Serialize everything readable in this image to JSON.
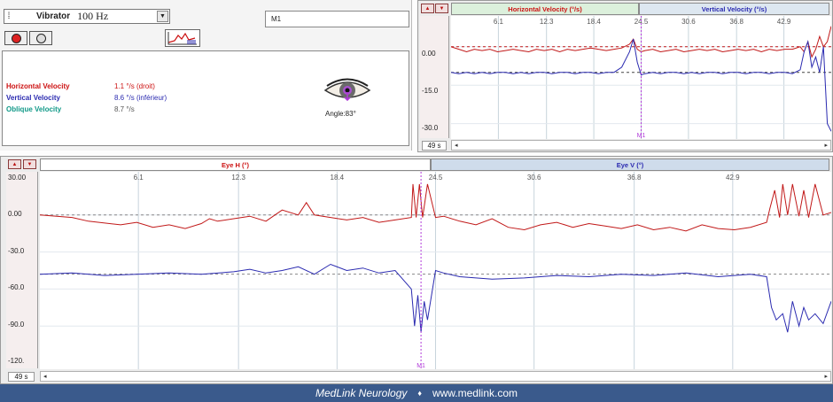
{
  "vibrator": {
    "label": "Vibrator",
    "value": "100 Hz"
  },
  "marker_field": "M1",
  "velocities": {
    "horizontal": {
      "label": "Horizontal Velocity",
      "value": "1.1 °/s (droit)"
    },
    "vertical": {
      "label": "Vertical Velocity",
      "value": "8.6 °/s (inférieur)"
    },
    "oblique": {
      "label": "Oblique Velocity",
      "value": "8.7 °/s"
    }
  },
  "angle_label": "Angle:83°",
  "small_chart": {
    "tabs": [
      "Horizontal Velocity (°/s)",
      "Vertical Velocity (°/s)"
    ],
    "y_ticks": [
      "0.00",
      "-15.0",
      "-30.0"
    ],
    "x_ticks": [
      "6.1",
      "12.3",
      "18.4",
      "24.5",
      "30.6",
      "36.8",
      "42.9"
    ],
    "time_window": "49 s",
    "cursor_label": "M1"
  },
  "big_chart": {
    "tabs": [
      "Eye H (°)",
      "Eye V (°)"
    ],
    "y_ticks": [
      "30.00",
      "0.00",
      "-30.0",
      "-60.0",
      "-90.0",
      "-120."
    ],
    "x_ticks": [
      "6.1",
      "12.3",
      "18.4",
      "24.5",
      "30.6",
      "36.8",
      "42.9"
    ],
    "time_window": "49 s",
    "cursor_label": "M1"
  },
  "chart_data": [
    {
      "type": "line",
      "title": "",
      "xlabel": "",
      "ylabel": "",
      "x_ticks": [
        6.1,
        12.3,
        18.4,
        24.5,
        30.6,
        36.8,
        42.9
      ],
      "xlim": [
        0,
        49
      ],
      "ylim": [
        -36,
        12
      ],
      "series": [
        {
          "name": "Horizontal Velocity (°/s)",
          "color": "#c11818",
          "x": [
            0,
            1,
            2,
            3,
            4,
            5,
            6,
            7,
            8,
            9,
            10,
            11,
            12,
            13,
            14,
            15,
            16,
            17,
            18,
            19,
            20,
            21,
            22,
            23,
            23.5,
            24,
            24.5,
            25,
            26,
            27,
            28,
            29,
            30,
            31,
            32,
            33,
            34,
            35,
            36,
            37,
            38,
            39,
            40,
            41,
            42,
            43,
            44,
            45,
            45.5,
            46,
            46.5,
            47,
            47.5,
            48,
            48.5,
            49
          ],
          "y": [
            0,
            -1,
            -2,
            -1,
            -1.5,
            -1,
            -2,
            -1.5,
            -1,
            -1.5,
            -2,
            -1,
            -1.5,
            -1,
            -2,
            -1,
            -1.5,
            -1,
            -0.5,
            -1,
            -1.5,
            -1,
            -0.5,
            1,
            3,
            -1,
            -2,
            -1.5,
            -1,
            -2,
            -1.5,
            -1,
            -2,
            -1.5,
            -1,
            -1.5,
            -1,
            -2,
            -1.5,
            -1,
            -1.5,
            -1,
            -2,
            -1,
            -1.5,
            -1,
            -1,
            0,
            -2,
            2,
            -4,
            -1,
            4,
            0,
            2,
            8
          ]
        },
        {
          "name": "Vertical Velocity (°/s)",
          "color": "#2a2ab0",
          "x": [
            0,
            1,
            2,
            3,
            4,
            5,
            6,
            7,
            8,
            9,
            10,
            11,
            12,
            13,
            14,
            15,
            16,
            17,
            18,
            19,
            20,
            21,
            22,
            23,
            23.5,
            24,
            24.5,
            25,
            26,
            27,
            28,
            29,
            30,
            31,
            32,
            33,
            34,
            35,
            36,
            37,
            38,
            39,
            40,
            41,
            42,
            43,
            44,
            45,
            45.5,
            46,
            46.5,
            47,
            47.5,
            48,
            48.5,
            49
          ],
          "y": [
            -10,
            -10.5,
            -10,
            -10.5,
            -10,
            -10.5,
            -10,
            -10,
            -10.5,
            -10,
            -10.5,
            -10,
            -10,
            -10.5,
            -10,
            -10,
            -10.5,
            -10,
            -10,
            -10.5,
            -10,
            -10,
            -8,
            -2,
            3,
            -6,
            -11,
            -10.5,
            -10,
            -10.5,
            -10,
            -10,
            -10.5,
            -10,
            -10.5,
            -10,
            -10,
            -10.5,
            -10,
            -10,
            -10.5,
            -10,
            -10,
            -10.5,
            -10,
            -10,
            -10.5,
            -9,
            -2,
            2,
            -8,
            -4,
            -10,
            0,
            -30,
            -33
          ]
        }
      ]
    },
    {
      "type": "line",
      "title": "",
      "xlabel": "",
      "ylabel": "",
      "x_ticks": [
        6.1,
        12.3,
        18.4,
        24.5,
        30.6,
        36.8,
        42.9
      ],
      "xlim": [
        0,
        49
      ],
      "ylim": [
        -125,
        35
      ],
      "series": [
        {
          "name": "Eye H (°)",
          "color": "#c11818",
          "x": [
            0,
            2,
            3,
            5,
            6,
            7,
            8,
            9,
            10,
            10.5,
            11,
            12,
            13,
            14,
            15,
            16,
            16.5,
            17,
            18,
            19,
            20,
            21,
            22,
            23,
            23.1,
            23.3,
            23.5,
            23.7,
            24,
            24.5,
            25,
            26,
            27,
            28,
            29,
            30,
            31,
            32,
            33,
            34,
            35,
            36,
            37,
            38,
            39,
            40,
            41,
            42,
            43,
            44,
            45,
            45.2,
            45.5,
            45.8,
            46,
            46.3,
            46.6,
            47,
            47.3,
            47.6,
            48,
            48.5,
            49
          ],
          "y": [
            0,
            -2,
            -5,
            -8,
            -6,
            -10,
            -8,
            -11,
            -7,
            -3,
            -5,
            -3,
            -1,
            -5,
            4,
            0,
            10,
            0,
            -2,
            -4,
            -2,
            -6,
            -4,
            -2,
            25,
            -2,
            25,
            -2,
            25,
            -2,
            -1,
            -5,
            -8,
            -3,
            -10,
            -12,
            -8,
            -6,
            -10,
            -7,
            -9,
            -11,
            -8,
            -12,
            -10,
            -13,
            -8,
            -11,
            -12,
            -10,
            -6,
            5,
            20,
            -2,
            25,
            0,
            25,
            -1,
            20,
            -2,
            25,
            0,
            2
          ]
        },
        {
          "name": "Eye V (°)",
          "color": "#2a2ab0",
          "x": [
            0,
            2,
            4,
            6,
            8,
            10,
            12,
            13,
            14,
            15,
            16,
            17,
            18,
            19,
            20,
            21,
            22,
            23,
            23.2,
            23.4,
            23.6,
            23.8,
            24,
            24.5,
            25,
            26,
            28,
            30,
            32,
            34,
            36,
            38,
            40,
            42,
            44,
            45,
            45.3,
            45.6,
            46,
            46.3,
            46.6,
            47,
            47.3,
            47.6,
            48,
            48.5,
            49
          ],
          "y": [
            -48,
            -47,
            -49,
            -48,
            -47,
            -48,
            -46,
            -44,
            -47,
            -45,
            -42,
            -48,
            -40,
            -45,
            -43,
            -47,
            -45,
            -60,
            -90,
            -65,
            -95,
            -70,
            -85,
            -45,
            -47,
            -50,
            -52,
            -51,
            -49,
            -50,
            -48,
            -49,
            -47,
            -50,
            -48,
            -50,
            -75,
            -85,
            -80,
            -95,
            -70,
            -90,
            -75,
            -85,
            -80,
            -88,
            -70
          ]
        }
      ]
    }
  ]
}
